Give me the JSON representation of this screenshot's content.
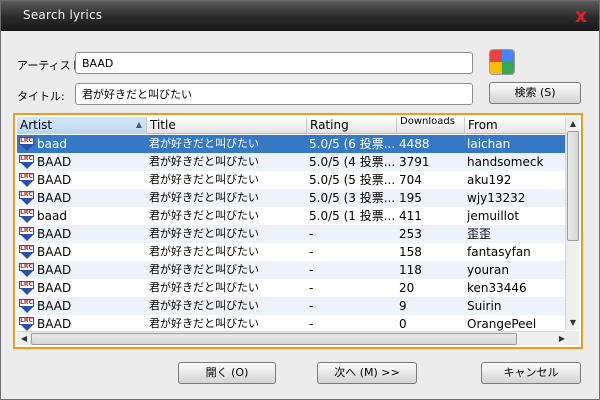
{
  "window": {
    "title": "Search lyrics",
    "close_glyph": "x"
  },
  "form": {
    "artist_label": "アーティスト:",
    "artist_value": "BAAD",
    "title_label": "タイトル:",
    "title_value": "君が好きだと叫びたい",
    "search_button": "検索 (S)"
  },
  "list": {
    "columns": [
      "Artist",
      "Title",
      "Rating",
      "Downloads",
      "From"
    ],
    "sorted_column": "Artist",
    "rows": [
      {
        "artist": "baad",
        "title": "君が好きだと叫びたい",
        "rating": "5.0/5 (6 投票...",
        "downloads": "4488",
        "from": "laichan",
        "selected": true
      },
      {
        "artist": "BAAD",
        "title": "君が好きだと叫びたい",
        "rating": "5.0/5 (4 投票...",
        "downloads": "3791",
        "from": "handsomeck"
      },
      {
        "artist": "BAAD",
        "title": "君が好きだと叫びたい",
        "rating": "5.0/5 (5 投票...",
        "downloads": "704",
        "from": "aku192"
      },
      {
        "artist": "BAAD",
        "title": "君が好きだと叫びたい",
        "rating": "5.0/5 (3 投票...",
        "downloads": "195",
        "from": "wjy13232"
      },
      {
        "artist": "baad",
        "title": "君が好きだと叫びたい",
        "rating": "5.0/5 (1 投票...",
        "downloads": "411",
        "from": "jemuillot"
      },
      {
        "artist": "BAAD",
        "title": "君が好きだと叫びたい",
        "rating": "-",
        "downloads": "253",
        "from": "歪歪"
      },
      {
        "artist": "BAAD",
        "title": "君が好きだと叫びたい",
        "rating": "-",
        "downloads": "158",
        "from": "fantasyfan"
      },
      {
        "artist": "BAAD",
        "title": "君が好きだと叫びたい",
        "rating": "-",
        "downloads": "118",
        "from": "youran"
      },
      {
        "artist": "BAAD",
        "title": "君が好きだと叫びたい",
        "rating": "-",
        "downloads": "20",
        "from": "ken33446"
      },
      {
        "artist": "BAAD",
        "title": "君が好きだと叫びたい",
        "rating": "-",
        "downloads": "9",
        "from": "Suirin"
      },
      {
        "artist": "BAAD",
        "title": "君が好きだと叫びたい",
        "rating": "-",
        "downloads": "0",
        "from": "OrangePeel"
      }
    ],
    "row_icon": "lrc-file-icon"
  },
  "footer": {
    "open_button": "開く (O)",
    "next_button": "次へ (M) >>",
    "cancel_button": "キャンセル"
  },
  "colors": {
    "accent_border": "#f29a1f",
    "selection": "#3478c6",
    "close_x": "#e02020"
  }
}
